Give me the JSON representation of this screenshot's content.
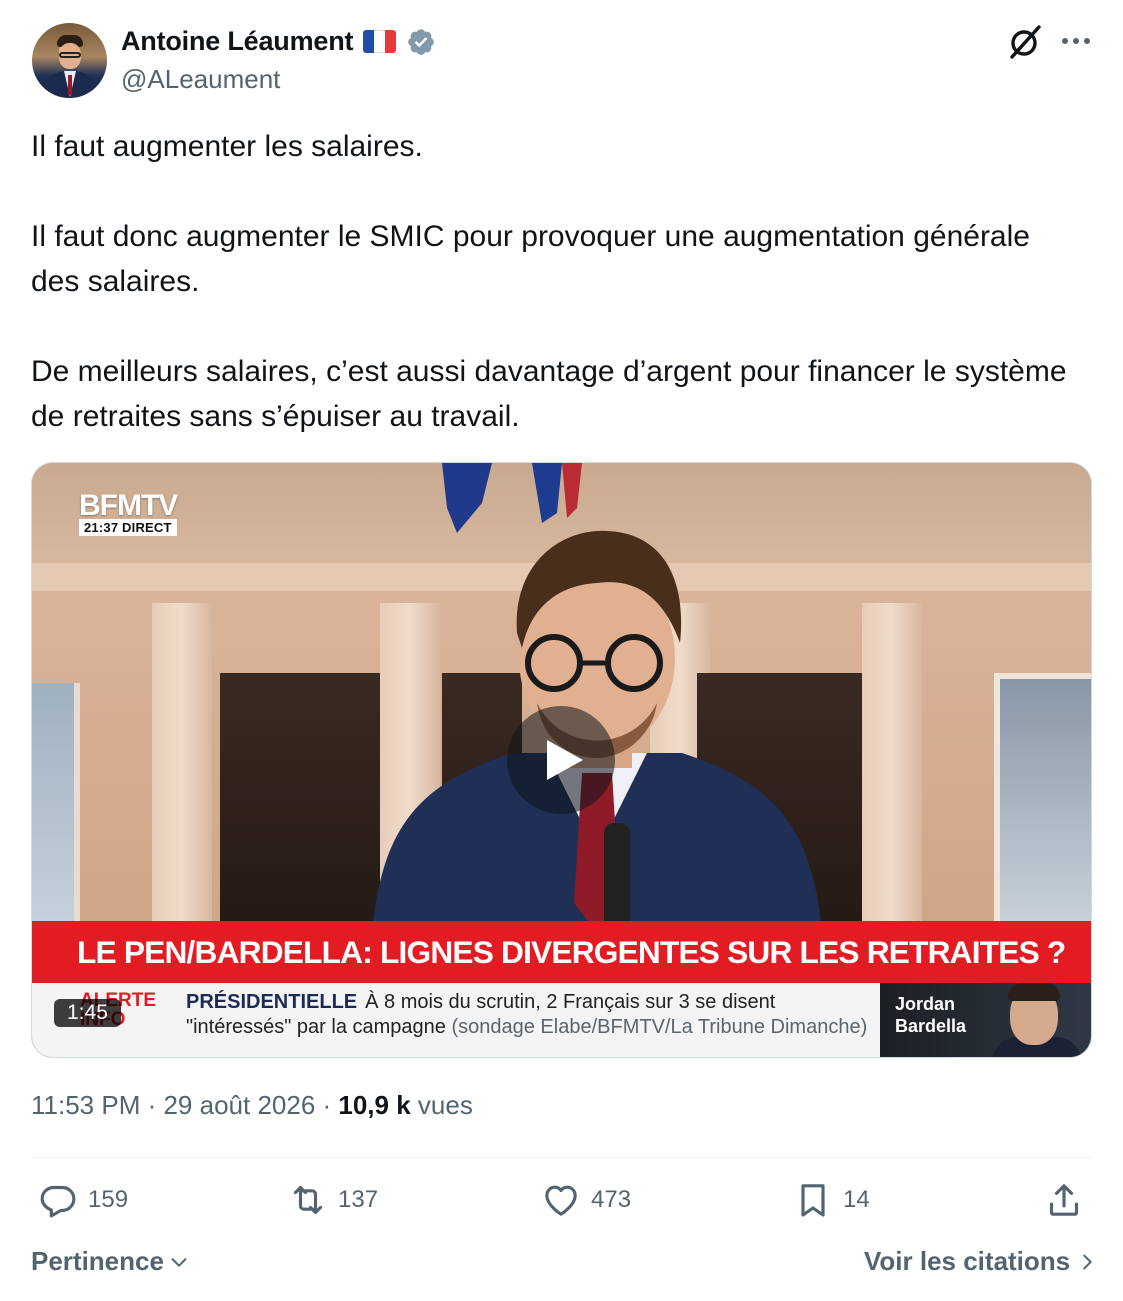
{
  "author": {
    "display_name": "Antoine Léaument",
    "handle": "@ALeaument",
    "flag": "france-flag-emoji",
    "verified_badge": "verified-badge-icon",
    "verified_color": "#829aab"
  },
  "header_actions": {
    "grok_icon": "grok-icon",
    "more_icon": "more-options-icon"
  },
  "tweet": {
    "paragraphs": [
      "Il faut augmenter les salaires.",
      "Il faut donc augmenter le SMIC pour provoquer une augmentation générale des salaires.",
      "De meilleurs salaires, c’est aussi davantage d’argent pour financer le système de retraites sans s’épuiser au travail."
    ]
  },
  "video": {
    "channel_logo": "BFMTV",
    "live_tag": "21:37  DIRECT",
    "headline": "LE PEN/BARDELLA: LIGNES DIVERGENTES SUR LES RETRAITES ?",
    "alert_label_1": "ALERTE",
    "alert_label_2": "INFO",
    "ticker_topic": "PRÉSIDENTIELLE",
    "ticker_line1": "À 8 mois du scrutin, 2 Français sur 3 se disent",
    "ticker_line2_main": "\"intéressés\" par la campagne",
    "ticker_line2_source": "(sondage Elabe/BFMTV/La Tribune Dimanche)",
    "guest_first": "Jordan",
    "guest_last": "Bardella",
    "duration": "1:45",
    "play_icon": "play-icon",
    "headline_color": "#e31b23"
  },
  "meta": {
    "time": "11:53 PM",
    "separator": " · ",
    "date": "29 août 2026",
    "views_count": "10,9 k",
    "views_label": "vues"
  },
  "actions": {
    "replies": "159",
    "reposts": "137",
    "likes": "473",
    "bookmarks": "14",
    "reply_icon": "reply-icon",
    "repost_icon": "repost-icon",
    "like_icon": "heart-icon",
    "bookmark_icon": "bookmark-icon",
    "share_icon": "share-icon"
  },
  "footer": {
    "sort_label": "Pertinence",
    "quotes_label": "Voir les citations"
  }
}
